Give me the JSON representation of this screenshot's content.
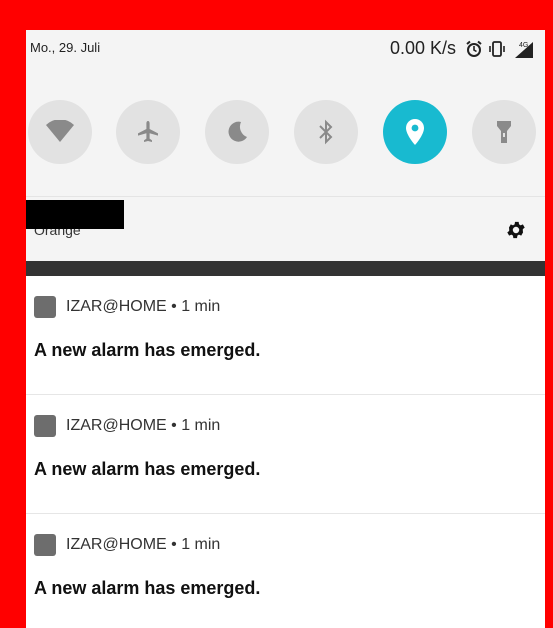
{
  "status_bar": {
    "date": "Mo., 29. Juli",
    "network_speed": "0.00 K/s",
    "icons": [
      "alarm-icon",
      "vibrate-icon",
      "signal-4g-icon"
    ]
  },
  "quick_settings": [
    {
      "name": "wifi",
      "icon": "wifi-icon",
      "active": false
    },
    {
      "name": "airplane",
      "icon": "airplane-icon",
      "active": false
    },
    {
      "name": "do-not-disturb",
      "icon": "moon-icon",
      "active": false
    },
    {
      "name": "bluetooth",
      "icon": "bluetooth-icon",
      "active": false
    },
    {
      "name": "location",
      "icon": "location-icon",
      "active": true
    },
    {
      "name": "flashlight",
      "icon": "flashlight-icon",
      "active": false
    }
  ],
  "carrier": "Orange",
  "notifications": [
    {
      "app": "IZAR@HOME",
      "separator": "•",
      "time": "1 min",
      "title": "A new alarm has emerged."
    },
    {
      "app": "IZAR@HOME",
      "separator": "•",
      "time": "1 min",
      "title": "A new alarm has emerged."
    },
    {
      "app": "IZAR@HOME",
      "separator": "•",
      "time": "1 min",
      "title": "A new alarm has emerged."
    }
  ],
  "colors": {
    "frame": "#ff0000",
    "tile_inactive": "#e2e2e2",
    "tile_active": "#18bad0",
    "app_icon": "#6d6d6d"
  }
}
